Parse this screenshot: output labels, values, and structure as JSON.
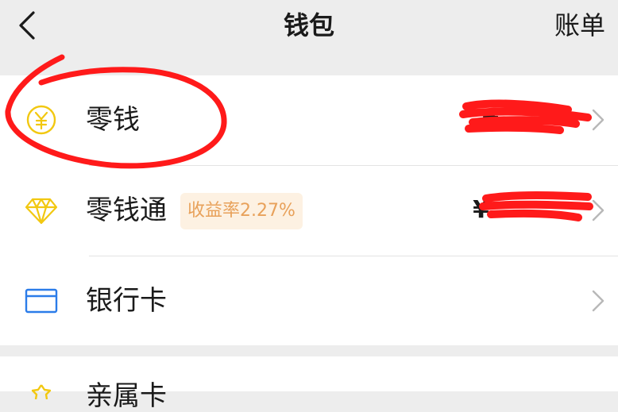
{
  "header": {
    "title": "钱包",
    "bill_label": "账单"
  },
  "wallet_items": [
    {
      "label": "零钱",
      "amount_prefix": "¥",
      "icon": "yuan-coin-icon"
    },
    {
      "label": "零钱通",
      "badge": "收益率2.27%",
      "amount_prefix": "¥",
      "icon": "diamond-icon"
    },
    {
      "label": "银行卡",
      "icon": "bank-card-icon"
    }
  ],
  "next_section": {
    "label": "亲属卡",
    "icon": "family-card-icon"
  },
  "colors": {
    "background": "#ededed",
    "card": "#ffffff",
    "icon_yellow": "#f2c811",
    "icon_blue": "#2b7ce9",
    "badge_text": "#e8a15a",
    "badge_bg": "#fdf1e2",
    "annotation_red": "#ff1a1a"
  }
}
